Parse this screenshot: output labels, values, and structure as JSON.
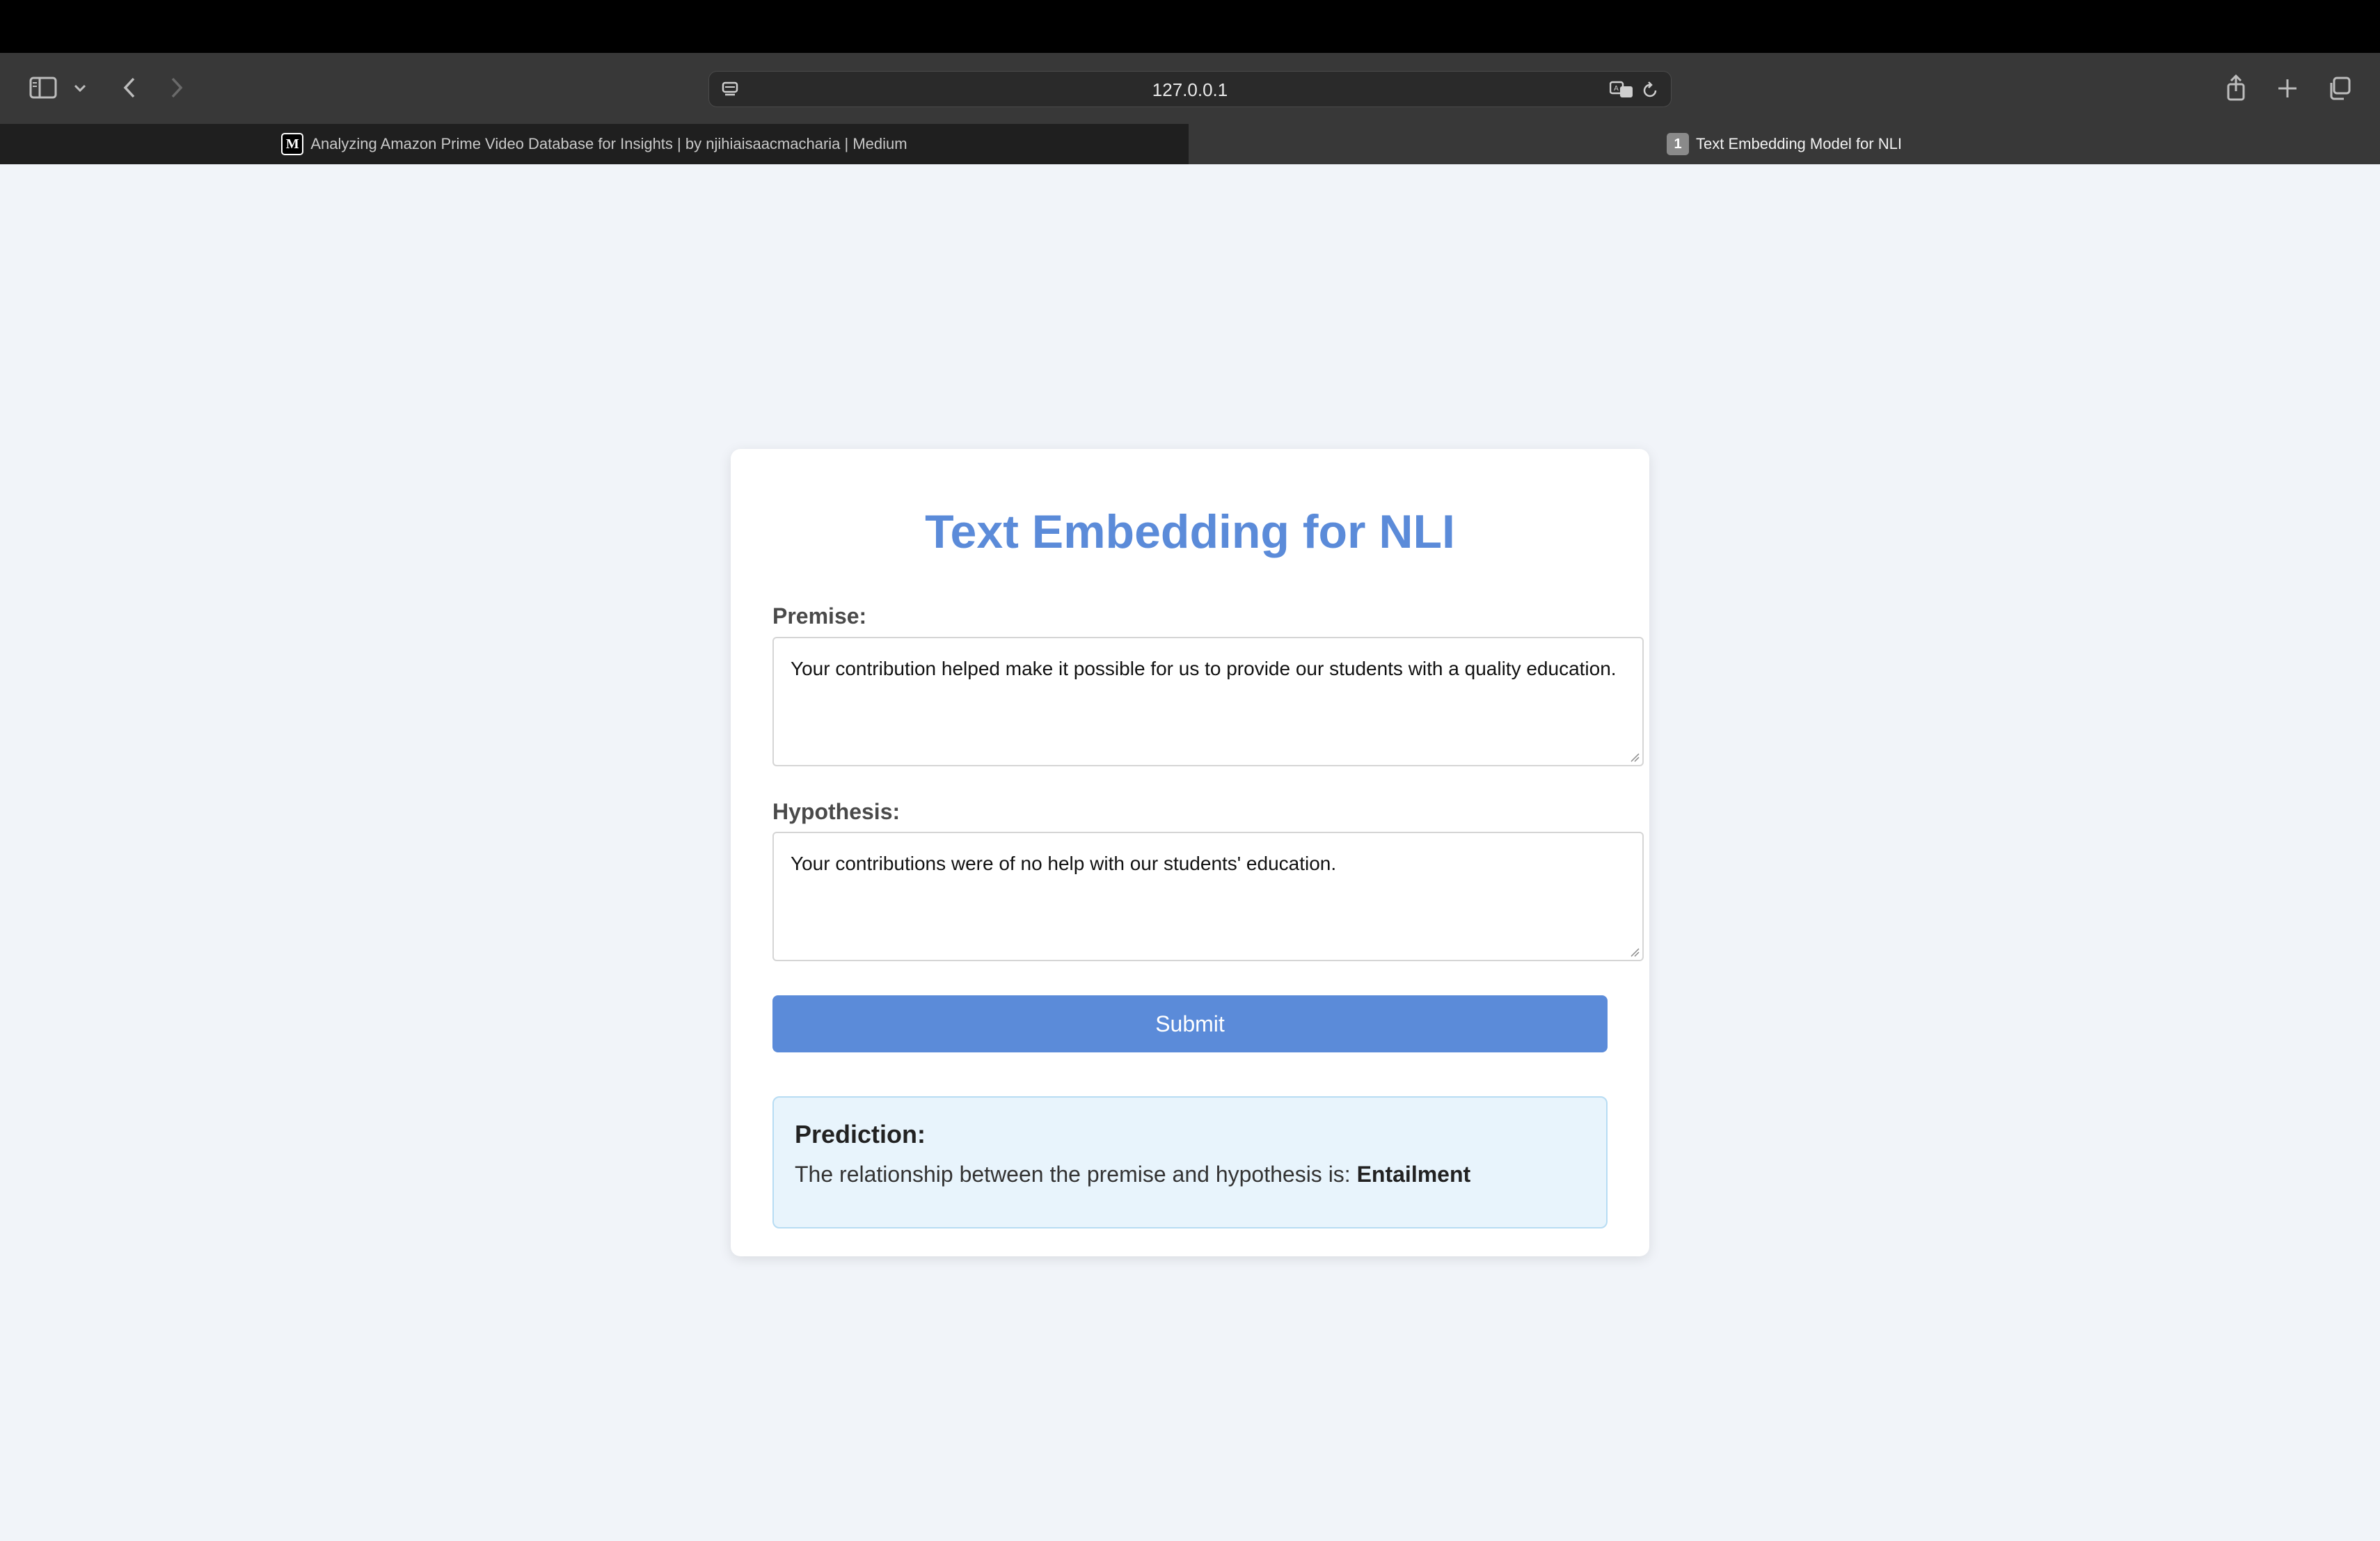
{
  "browser": {
    "url": "127.0.0.1",
    "tabs": [
      {
        "label": "Analyzing Amazon Prime Video Database for Insights | by njihiaisaacmacharia | Medium",
        "favicon": "M",
        "active": false
      },
      {
        "label": "Text Embedding Model for NLI",
        "favicon": "1",
        "active": true
      }
    ],
    "icons": [
      "sidebar-icon",
      "chevron-down-icon",
      "back-icon",
      "forward-icon",
      "page-menu-icon",
      "translate-icon",
      "reload-icon",
      "share-icon",
      "new-tab-icon",
      "tab-overview-icon"
    ]
  },
  "page": {
    "title": "Text Embedding for NLI",
    "premise_label": "Premise:",
    "premise_value": "Your contribution helped make it possible for us to provide our students with a quality education.",
    "hypothesis_label": "Hypothesis:",
    "hypothesis_value": "Your contributions were of no help with our students' education.",
    "submit_label": "Submit",
    "prediction_title": "Prediction:",
    "prediction_prefix": "The relationship between the premise and hypothesis is: ",
    "prediction_value": "Entailment"
  },
  "colors": {
    "accent": "#5b8bd9",
    "result_bg": "#e8f4fc",
    "result_border": "#b7dcf3",
    "page_bg": "#f1f4f9"
  }
}
